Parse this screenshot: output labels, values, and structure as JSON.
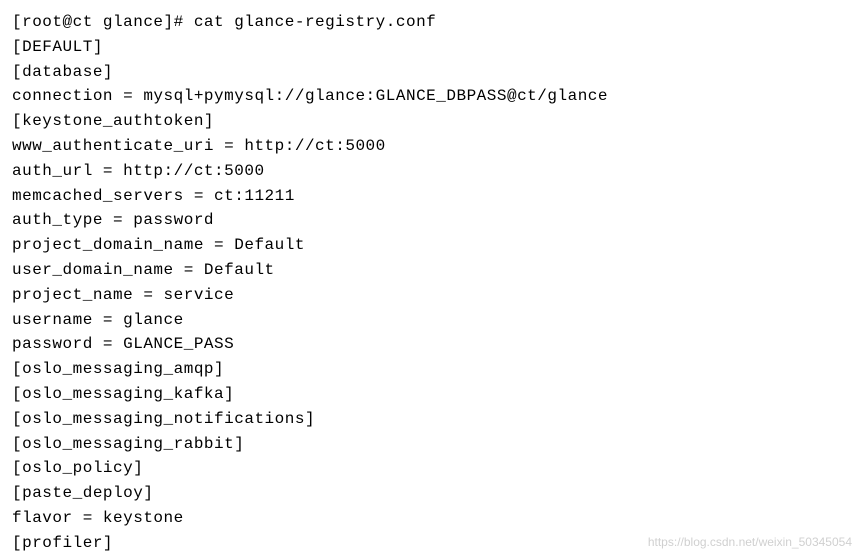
{
  "lines": [
    "[root@ct glance]# cat glance-registry.conf",
    "[DEFAULT]",
    "[database]",
    "connection = mysql+pymysql://glance:GLANCE_DBPASS@ct/glance",
    "[keystone_authtoken]",
    "www_authenticate_uri = http://ct:5000",
    "auth_url = http://ct:5000",
    "memcached_servers = ct:11211",
    "auth_type = password",
    "project_domain_name = Default",
    "user_domain_name = Default",
    "project_name = service",
    "username = glance",
    "password = GLANCE_PASS",
    "[oslo_messaging_amqp]",
    "[oslo_messaging_kafka]",
    "[oslo_messaging_notifications]",
    "[oslo_messaging_rabbit]",
    "[oslo_policy]",
    "[paste_deploy]",
    "flavor = keystone",
    "[profiler]"
  ],
  "watermark": "https://blog.csdn.net/weixin_50345054"
}
